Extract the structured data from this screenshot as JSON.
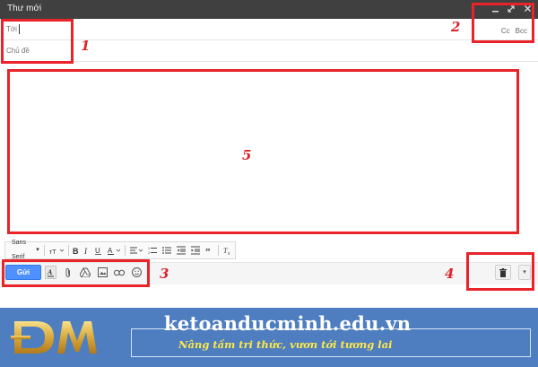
{
  "window": {
    "title": "Thư mới",
    "controls": [
      "minimize-icon",
      "expand-icon",
      "close-icon"
    ]
  },
  "compose": {
    "to_label": "Tới",
    "to_value": "",
    "subject_label": "Chủ đề",
    "subject_value": "",
    "cc_label": "Cc",
    "bcc_label": "Bcc",
    "body_value": ""
  },
  "format_toolbar": {
    "font": "Sans Serif",
    "items": [
      "font-size-icon",
      "bold-icon",
      "italic-icon",
      "underline-icon",
      "text-color-icon",
      "align-icon",
      "numbered-list-icon",
      "bulleted-list-icon",
      "indent-less-icon",
      "indent-more-icon",
      "quote-icon",
      "remove-formatting-icon"
    ]
  },
  "actions": {
    "send_label": "Gửi",
    "icons": [
      "formatting-toggle-icon",
      "attach-icon",
      "drive-icon",
      "photo-icon",
      "link-icon",
      "emoji-icon",
      "trash-icon",
      "more-options-icon"
    ]
  },
  "annotations": {
    "labels": [
      "1",
      "2",
      "3",
      "4",
      "5"
    ],
    "color": "#e8232a"
  },
  "banner": {
    "site": "ketoanducminh.edu.vn",
    "tagline": "Nâng tầm tri thức, vươn tới tương lai",
    "background": "#4e7ec0",
    "tagline_color": "#ffe84a"
  },
  "colors": {
    "titlebar": "#404040",
    "send_button": "#4d90fe"
  }
}
